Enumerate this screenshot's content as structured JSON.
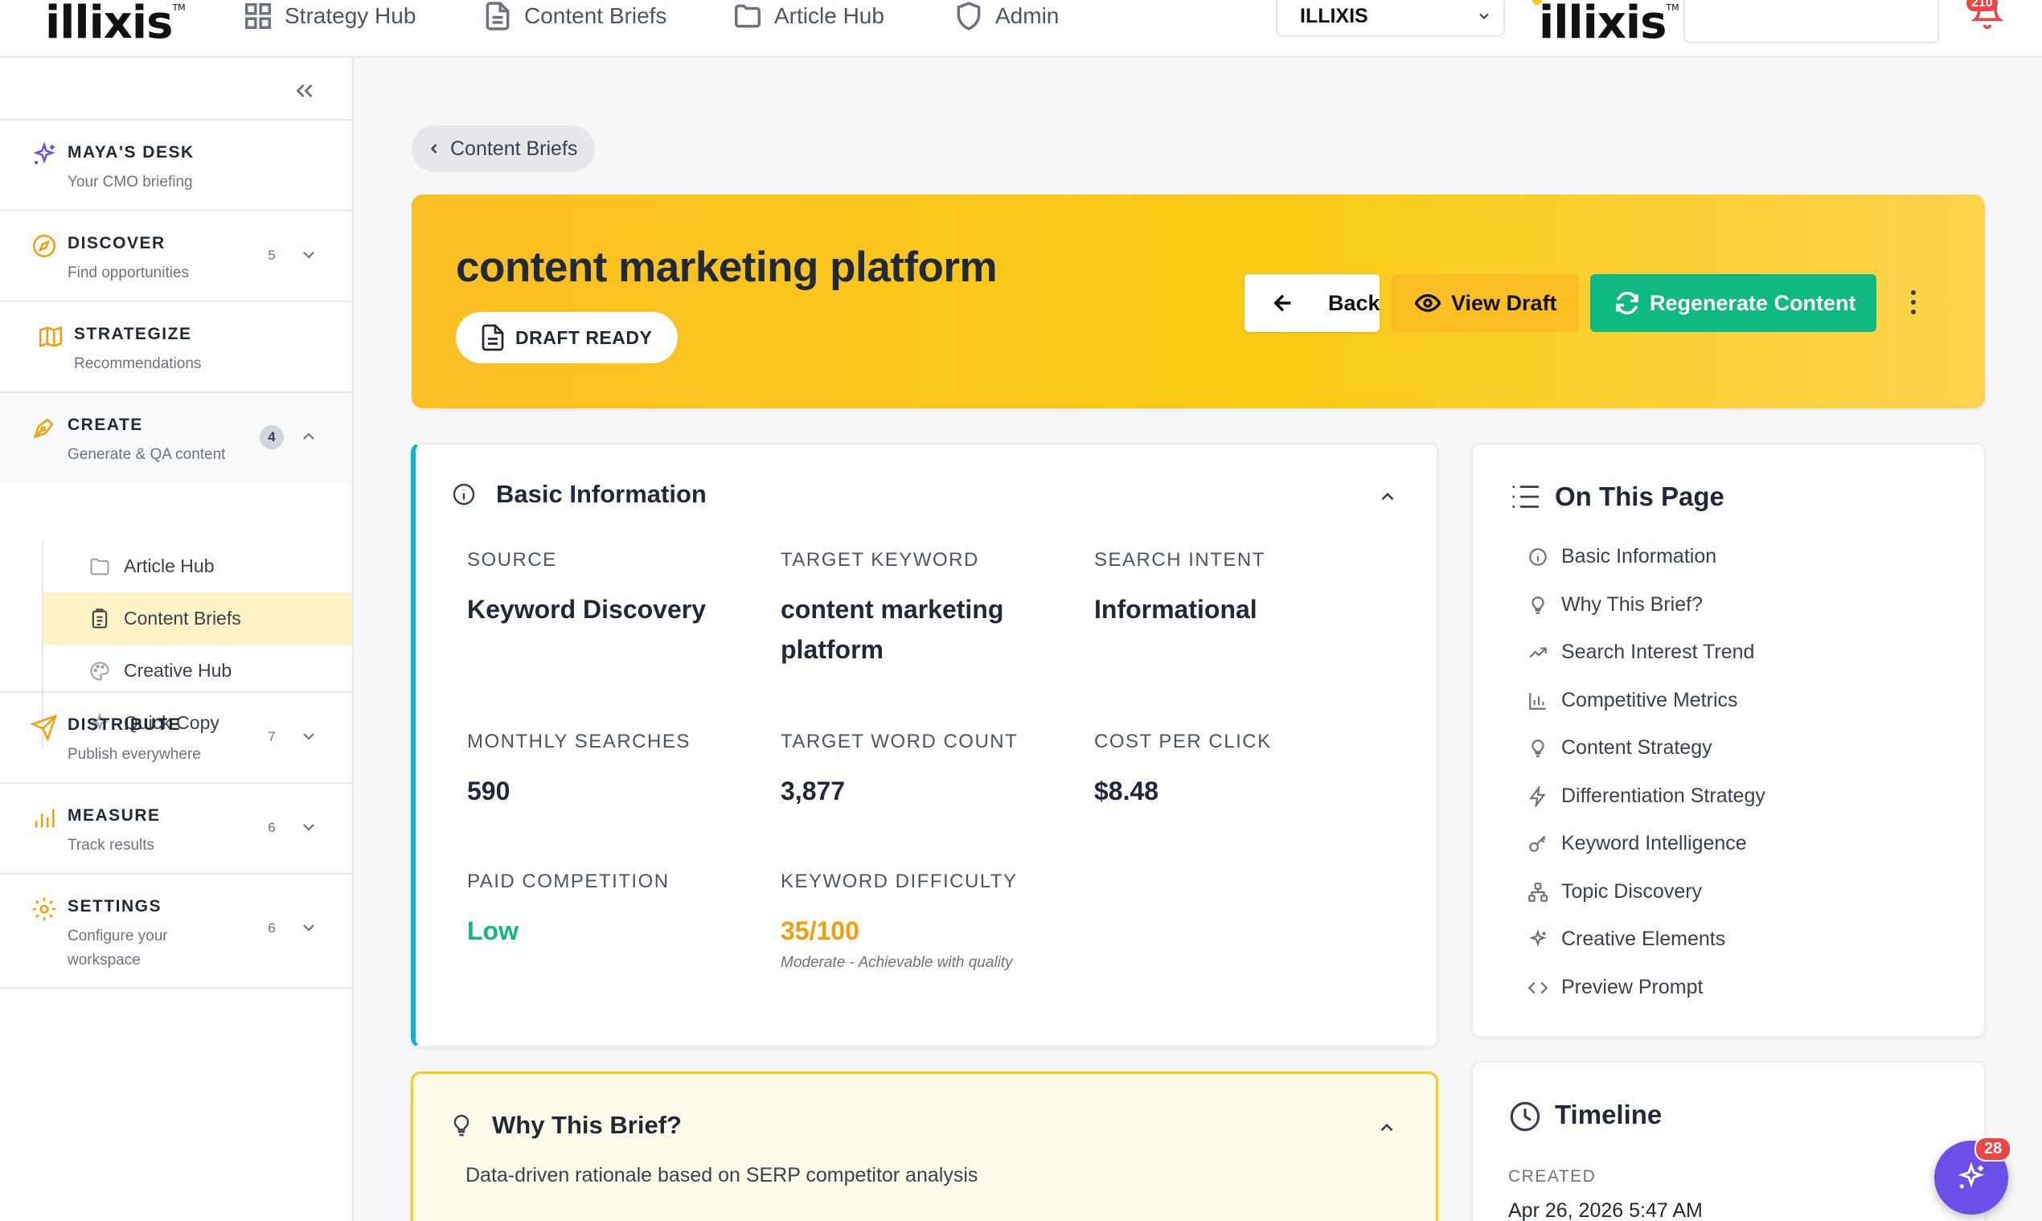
{
  "brand": {
    "name": "illixis",
    "tm": "TM"
  },
  "topnav": [
    {
      "label": "Strategy Hub",
      "icon": "grid-icon"
    },
    {
      "label": "Content Briefs",
      "icon": "document-icon"
    },
    {
      "label": "Article Hub",
      "icon": "folder-icon"
    },
    {
      "label": "Admin",
      "icon": "shield-icon"
    }
  ],
  "org_select": {
    "value": "ILLIXIS"
  },
  "notifications": {
    "count": "210"
  },
  "sidebar": {
    "sections": [
      {
        "title": "MAYA'S DESK",
        "sub": "Your CMO briefing",
        "count": ""
      },
      {
        "title": "DISCOVER",
        "sub": "Find opportunities",
        "count": "5"
      },
      {
        "title": "STRATEGIZE",
        "sub": "Recommendations",
        "count": ""
      },
      {
        "title": "CREATE",
        "sub": "Generate & QA content",
        "count": "4"
      },
      {
        "title": "DISTRIBUTE",
        "sub": "Publish everywhere",
        "count": "7"
      },
      {
        "title": "MEASURE",
        "sub": "Track results",
        "count": "6"
      },
      {
        "title": "SETTINGS",
        "sub": "Configure your workspace",
        "count": "6"
      }
    ],
    "create_items": [
      {
        "label": "Article Hub"
      },
      {
        "label": "Content Briefs"
      },
      {
        "label": "Creative Hub"
      },
      {
        "label": "Quick Copy"
      }
    ]
  },
  "breadcrumb": {
    "label": "Content Briefs"
  },
  "hero": {
    "title": "content marketing platform",
    "status": "DRAFT READY",
    "back_label": "Back",
    "view_label": "View Draft",
    "regen_label": "Regenerate Content"
  },
  "basic_info": {
    "heading": "Basic Information",
    "fields": [
      {
        "label": "SOURCE",
        "value": "Keyword Discovery"
      },
      {
        "label": "TARGET KEYWORD",
        "value": "content marketing platform"
      },
      {
        "label": "SEARCH INTENT",
        "value": "Informational"
      },
      {
        "label": "MONTHLY SEARCHES",
        "value": "590"
      },
      {
        "label": "TARGET WORD COUNT",
        "value": "3,877"
      },
      {
        "label": "COST PER CLICK",
        "value": "$8.48"
      },
      {
        "label": "PAID COMPETITION",
        "value": "Low"
      },
      {
        "label": "KEYWORD DIFFICULTY",
        "value": "35/100",
        "note": "Moderate - Achievable with quality"
      }
    ]
  },
  "why": {
    "heading": "Why This Brief?",
    "desc": "Data-driven rationale based on SERP competitor analysis"
  },
  "on_this_page": {
    "title": "On This Page",
    "items": [
      "Basic Information",
      "Why This Brief?",
      "Search Interest Trend",
      "Competitive Metrics",
      "Content Strategy",
      "Differentiation Strategy",
      "Keyword Intelligence",
      "Topic Discovery",
      "Creative Elements",
      "Preview Prompt"
    ]
  },
  "timeline": {
    "title": "Timeline",
    "created_label": "CREATED",
    "created_value": "Apr 26, 2026 5:47 AM"
  },
  "assistant": {
    "badge": "28"
  },
  "colors": {
    "accent_yellow": "#facc15",
    "success_green": "#10b981",
    "info_cyan": "#06b6d4",
    "assistant_purple": "#6d4ee6"
  }
}
